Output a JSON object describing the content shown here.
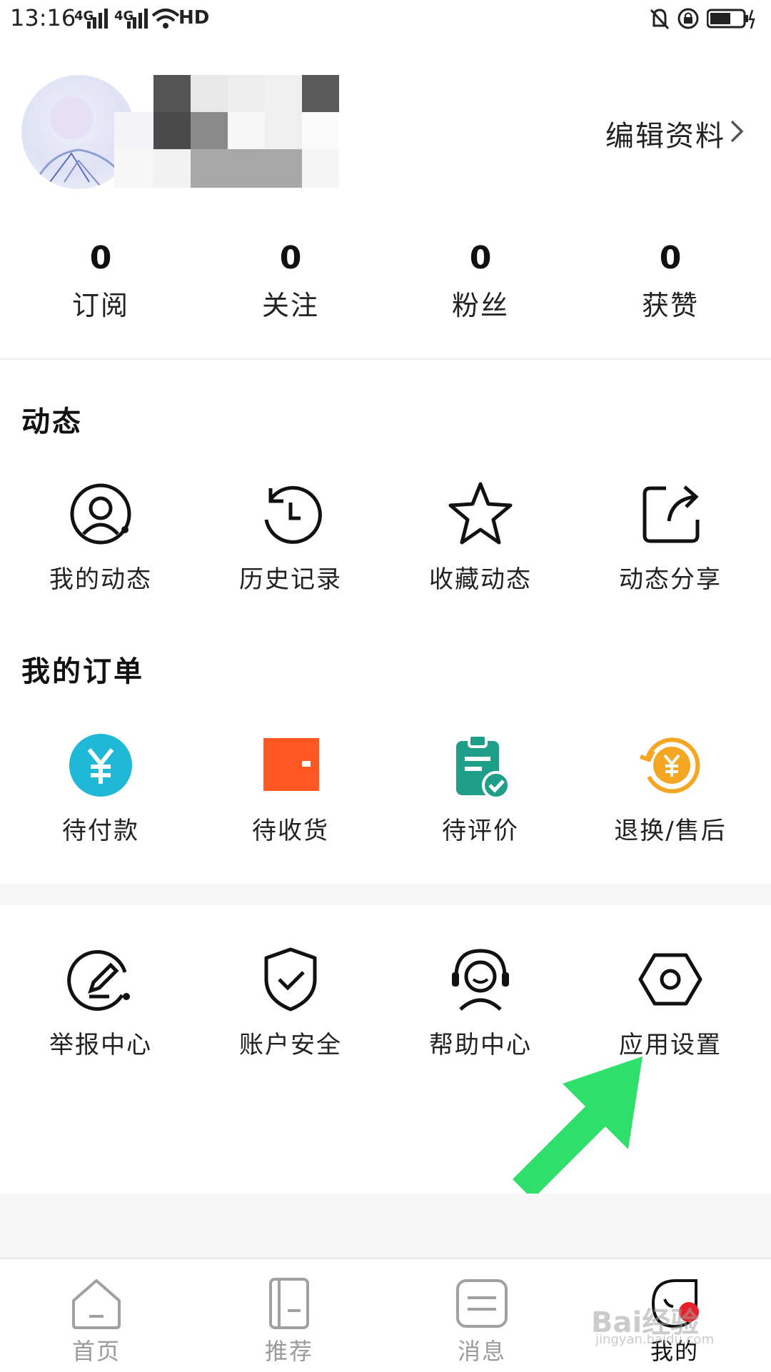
{
  "status_bar": {
    "time": "13:16",
    "signal1": "4G",
    "signal2": "4G",
    "hd": "HD"
  },
  "profile": {
    "edit_label": "编辑资料"
  },
  "stats": [
    {
      "value": "0",
      "label": "订阅"
    },
    {
      "value": "0",
      "label": "关注"
    },
    {
      "value": "0",
      "label": "粉丝"
    },
    {
      "value": "0",
      "label": "获赞"
    }
  ],
  "dynamics": {
    "title": "动态",
    "items": [
      {
        "label": "我的动态",
        "icon": "user-circle-icon"
      },
      {
        "label": "历史记录",
        "icon": "history-icon"
      },
      {
        "label": "收藏动态",
        "icon": "star-icon"
      },
      {
        "label": "动态分享",
        "icon": "share-icon"
      }
    ]
  },
  "orders": {
    "title": "我的订单",
    "items": [
      {
        "label": "待付款",
        "icon": "yen-icon",
        "color": "#1fb8d6"
      },
      {
        "label": "待收货",
        "icon": "wallet-icon",
        "color": "#ff5722"
      },
      {
        "label": "待评价",
        "icon": "clipboard-check-icon",
        "color": "#1f9e8a"
      },
      {
        "label": "退换/售后",
        "icon": "refund-icon",
        "color": "#f5a623"
      }
    ]
  },
  "services": {
    "items": [
      {
        "label": "举报中心",
        "icon": "report-pen-icon"
      },
      {
        "label": "账户安全",
        "icon": "shield-check-icon"
      },
      {
        "label": "帮助中心",
        "icon": "headset-icon"
      },
      {
        "label": "应用设置",
        "icon": "hex-gear-icon"
      }
    ]
  },
  "annotation": {
    "color": "#2ee06a"
  },
  "bottom_nav": {
    "items": [
      {
        "label": "首页",
        "icon": "home-icon"
      },
      {
        "label": "推荐",
        "icon": "book-icon"
      },
      {
        "label": "消息",
        "icon": "message-icon"
      },
      {
        "label": "我的",
        "icon": "profile-icon",
        "active": true
      }
    ]
  },
  "watermark": {
    "text": "Bai经验",
    "sub": "jingyan.baidu.com"
  }
}
